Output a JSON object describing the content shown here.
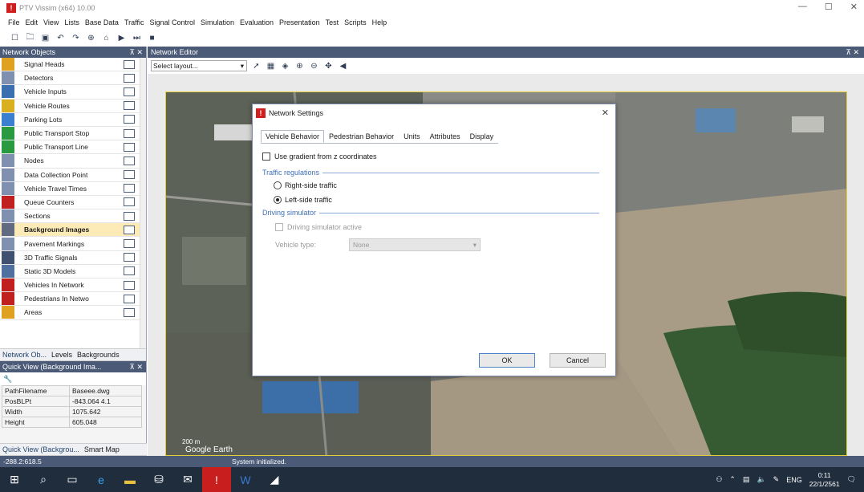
{
  "window": {
    "title": "PTV Vissim (x64) 10.00",
    "controls": [
      "—",
      "☐",
      "✕"
    ]
  },
  "menu": [
    "File",
    "Edit",
    "View",
    "Lists",
    "Base Data",
    "Traffic",
    "Signal Control",
    "Simulation",
    "Evaluation",
    "Presentation",
    "Test",
    "Scripts",
    "Help"
  ],
  "network_objects": {
    "header": "Network Objects",
    "items": [
      {
        "label": "Signal Heads",
        "icon_color": "#e0a020"
      },
      {
        "label": "Detectors",
        "icon_color": "#8090b0"
      },
      {
        "label": "Vehicle Inputs",
        "icon_color": "#3a6fb0"
      },
      {
        "label": "Vehicle Routes",
        "icon_color": "#d8b020"
      },
      {
        "label": "Parking Lots",
        "icon_color": "#3a7fd0"
      },
      {
        "label": "Public Transport Stop",
        "icon_color": "#2a9a40"
      },
      {
        "label": "Public Transport Line",
        "icon_color": "#2a9a40"
      },
      {
        "label": "Nodes",
        "icon_color": "#8090b0"
      },
      {
        "label": "Data Collection Point",
        "icon_color": "#8090b0"
      },
      {
        "label": "Vehicle Travel Times",
        "icon_color": "#8090b0"
      },
      {
        "label": "Queue Counters",
        "icon_color": "#c02020"
      },
      {
        "label": "Sections",
        "icon_color": "#8090b0"
      },
      {
        "label": "Background Images",
        "icon_color": "#606a80"
      },
      {
        "label": "Pavement Markings",
        "icon_color": "#8090b0"
      },
      {
        "label": "3D Traffic Signals",
        "icon_color": "#405070"
      },
      {
        "label": "Static 3D Models",
        "icon_color": "#5070a0"
      },
      {
        "label": "Vehicles In Network",
        "icon_color": "#c02020"
      },
      {
        "label": "Pedestrians In Netwo",
        "icon_color": "#c02020"
      },
      {
        "label": "Areas",
        "icon_color": "#e0a020"
      }
    ],
    "active_index": 12,
    "tabs": [
      "Network Ob...",
      "Levels",
      "Backgrounds"
    ]
  },
  "quick_view": {
    "header": "Quick View (Background Ima...",
    "rows": [
      {
        "key": "PathFilename",
        "value": "Baseee.dwg"
      },
      {
        "key": "PosBLPt",
        "value": "-843.064 4.1"
      },
      {
        "key": "Width",
        "value": "1075.642"
      },
      {
        "key": "Height",
        "value": "605.048"
      }
    ],
    "tabs": [
      "Quick View (Backgrou...",
      "Smart Map"
    ]
  },
  "editor": {
    "header": "Network Editor",
    "layout_placeholder": "Select layout...",
    "scale_label": "200 m",
    "map_watermark": "Google Earth"
  },
  "dialog": {
    "title": "Network Settings",
    "tabs": [
      "Vehicle Behavior",
      "Pedestrian Behavior",
      "Units",
      "Attributes",
      "Display"
    ],
    "selected_tab": 0,
    "use_gradient_label": "Use gradient from z coordinates",
    "traffic_regulations_label": "Traffic regulations",
    "right_side_label": "Right-side traffic",
    "left_side_label": "Left-side traffic",
    "selected_regulation": "left",
    "driving_simulator_label": "Driving simulator",
    "driving_simulator_active_label": "Driving simulator active",
    "vehicle_type_label": "Vehicle type:",
    "vehicle_type_value": "None",
    "ok_label": "OK",
    "cancel_label": "Cancel"
  },
  "status": {
    "coords": "-288.2:618.5",
    "message": "System initialized."
  },
  "taskbar": {
    "language": "ENG",
    "time": "0:11",
    "date": "22/1/2561"
  }
}
